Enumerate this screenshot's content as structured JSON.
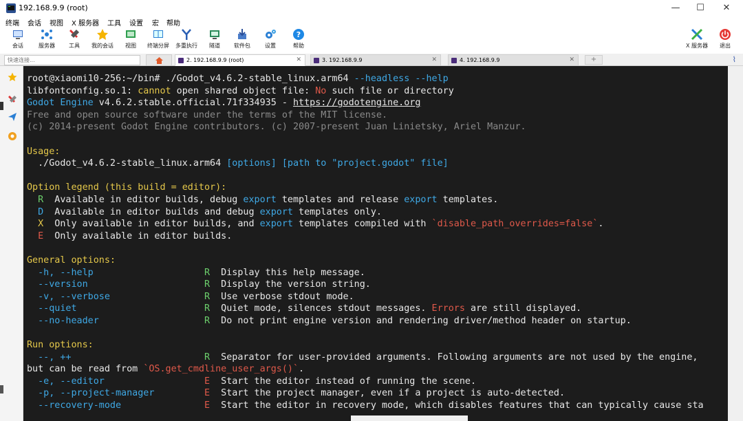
{
  "window": {
    "title": "192.168.9.9 (root)",
    "minimize": "—",
    "maximize": "☐",
    "close": "✕"
  },
  "menu": [
    "终端",
    "会话",
    "视图",
    "X 服务器",
    "工具",
    "设置",
    "宏",
    "帮助"
  ],
  "toolbar": {
    "items": [
      {
        "label": "会话",
        "icon": "session-icon"
      },
      {
        "label": "服务器",
        "icon": "servers-icon"
      },
      {
        "label": "工具",
        "icon": "tools-icon"
      },
      {
        "label": "我的会话",
        "icon": "star-icon"
      },
      {
        "label": "视图",
        "icon": "view-icon"
      },
      {
        "label": "终端分屏",
        "icon": "split-icon"
      },
      {
        "label": "多重执行",
        "icon": "multiexec-icon"
      },
      {
        "label": "隧道",
        "icon": "tunnel-icon"
      },
      {
        "label": "软件包",
        "icon": "packages-icon"
      },
      {
        "label": "设置",
        "icon": "gear-icon"
      },
      {
        "label": "帮助",
        "icon": "help-icon"
      }
    ],
    "right": [
      {
        "label": "X 服务器",
        "icon": "x-server-icon"
      },
      {
        "label": "退出",
        "icon": "power-icon"
      }
    ]
  },
  "quick_connect": {
    "placeholder": "快速连接..."
  },
  "tabs": [
    {
      "label": "2. 192.168.9.9 (root)",
      "active": true
    },
    {
      "label": "3. 192.168.9.9",
      "active": false
    },
    {
      "label": "4. 192.168.9.9",
      "active": false
    }
  ],
  "terminal": {
    "lines": [
      [
        [
          "w",
          "root@xiaomi10-256:~/bin# ./Godot_v4.6.2-stable_linux.arm64 "
        ],
        [
          "c",
          "--headless --help"
        ]
      ],
      [
        [
          "w",
          "libfontconfig.so.1: "
        ],
        [
          "y",
          "cannot"
        ],
        [
          "w",
          " open shared object file: "
        ],
        [
          "r",
          "No"
        ],
        [
          "w",
          " such file or directory"
        ]
      ],
      [
        [
          "c",
          "Godot Engine"
        ],
        [
          "w",
          " v4.6.2.stable.official.71f334935 - "
        ],
        [
          "wu",
          "https://godotengine.org"
        ]
      ],
      [
        [
          "gr",
          "Free and open source software under the terms of the MIT license."
        ]
      ],
      [
        [
          "gr",
          "(c) 2014-present Godot Engine contributors. (c) 2007-present Juan Linietsky, Ariel Manzur."
        ]
      ],
      [
        [
          "w",
          ""
        ]
      ],
      [
        [
          "y",
          "Usage:"
        ]
      ],
      [
        [
          "w",
          "  ./Godot_v4.6.2-stable_linux.arm64 "
        ],
        [
          "c",
          "[options] [path to \"project.godot\" file]"
        ]
      ],
      [
        [
          "w",
          ""
        ]
      ],
      [
        [
          "y",
          "Option legend (this build = editor):"
        ]
      ],
      [
        [
          "w",
          "  "
        ],
        [
          "g",
          "R"
        ],
        [
          "w",
          "  Available in editor builds, debug "
        ],
        [
          "c",
          "export"
        ],
        [
          "w",
          " templates and release "
        ],
        [
          "c",
          "export"
        ],
        [
          "w",
          " templates."
        ]
      ],
      [
        [
          "w",
          "  "
        ],
        [
          "c",
          "D"
        ],
        [
          "w",
          "  Available in editor builds and debug "
        ],
        [
          "c",
          "export"
        ],
        [
          "w",
          " templates only."
        ]
      ],
      [
        [
          "w",
          "  "
        ],
        [
          "y",
          "X"
        ],
        [
          "w",
          "  Only available in editor builds, and "
        ],
        [
          "c",
          "export"
        ],
        [
          "w",
          " templates compiled with "
        ],
        [
          "r",
          "`disable_path_overrides=false`"
        ],
        [
          "w",
          "."
        ]
      ],
      [
        [
          "w",
          "  "
        ],
        [
          "r",
          "E"
        ],
        [
          "w",
          "  Only available in editor builds."
        ]
      ],
      [
        [
          "w",
          ""
        ]
      ],
      [
        [
          "y",
          "General options:"
        ]
      ],
      [
        [
          "w",
          "  "
        ],
        [
          "c",
          "-h, --help"
        ],
        [
          "w",
          "                    "
        ],
        [
          "g",
          "R"
        ],
        [
          "w",
          "  Display this help message."
        ]
      ],
      [
        [
          "w",
          "  "
        ],
        [
          "c",
          "--version"
        ],
        [
          "w",
          "                     "
        ],
        [
          "g",
          "R"
        ],
        [
          "w",
          "  Display the version string."
        ]
      ],
      [
        [
          "w",
          "  "
        ],
        [
          "c",
          "-v, --verbose"
        ],
        [
          "w",
          "                 "
        ],
        [
          "g",
          "R"
        ],
        [
          "w",
          "  Use verbose stdout mode."
        ]
      ],
      [
        [
          "w",
          "  "
        ],
        [
          "c",
          "--quiet"
        ],
        [
          "w",
          "                       "
        ],
        [
          "g",
          "R"
        ],
        [
          "w",
          "  Quiet mode, silences stdout messages. "
        ],
        [
          "r",
          "Errors"
        ],
        [
          "w",
          " are still displayed."
        ]
      ],
      [
        [
          "w",
          "  "
        ],
        [
          "c",
          "--no-header"
        ],
        [
          "w",
          "                   "
        ],
        [
          "g",
          "R"
        ],
        [
          "w",
          "  Do not print engine version and rendering driver/method header on startup."
        ]
      ],
      [
        [
          "w",
          ""
        ]
      ],
      [
        [
          "y",
          "Run options:"
        ]
      ],
      [
        [
          "w",
          "  "
        ],
        [
          "c",
          "--, ++"
        ],
        [
          "w",
          "                        "
        ],
        [
          "g",
          "R"
        ],
        [
          "w",
          "  Separator for user-provided arguments. Following arguments are not used by the engine,"
        ]
      ],
      [
        [
          "w",
          "but can be read from "
        ],
        [
          "r",
          "`OS.get_cmdline_user_args()`"
        ],
        [
          "w",
          "."
        ]
      ],
      [
        [
          "w",
          "  "
        ],
        [
          "c",
          "-e, --editor"
        ],
        [
          "w",
          "                  "
        ],
        [
          "r",
          "E"
        ],
        [
          "w",
          "  Start the editor instead of running the scene."
        ]
      ],
      [
        [
          "w",
          "  "
        ],
        [
          "c",
          "-p, --project-manager"
        ],
        [
          "w",
          "         "
        ],
        [
          "r",
          "E"
        ],
        [
          "w",
          "  Start the project manager, even if a project is auto-detected."
        ]
      ],
      [
        [
          "w",
          "  "
        ],
        [
          "c",
          "--recovery-mode"
        ],
        [
          "w",
          "               "
        ],
        [
          "r",
          "E"
        ],
        [
          "w",
          "  Start the editor in recovery mode, which disables features that can typically cause sta"
        ]
      ]
    ]
  },
  "colors": {
    "terminal_bg": "#1c1c1c",
    "text": "#e8e8e8",
    "yellow": "#e5c84a",
    "cyan": "#3fa9e6",
    "green": "#6cd06c",
    "red": "#e0594a",
    "gray": "#8a8a8a"
  }
}
